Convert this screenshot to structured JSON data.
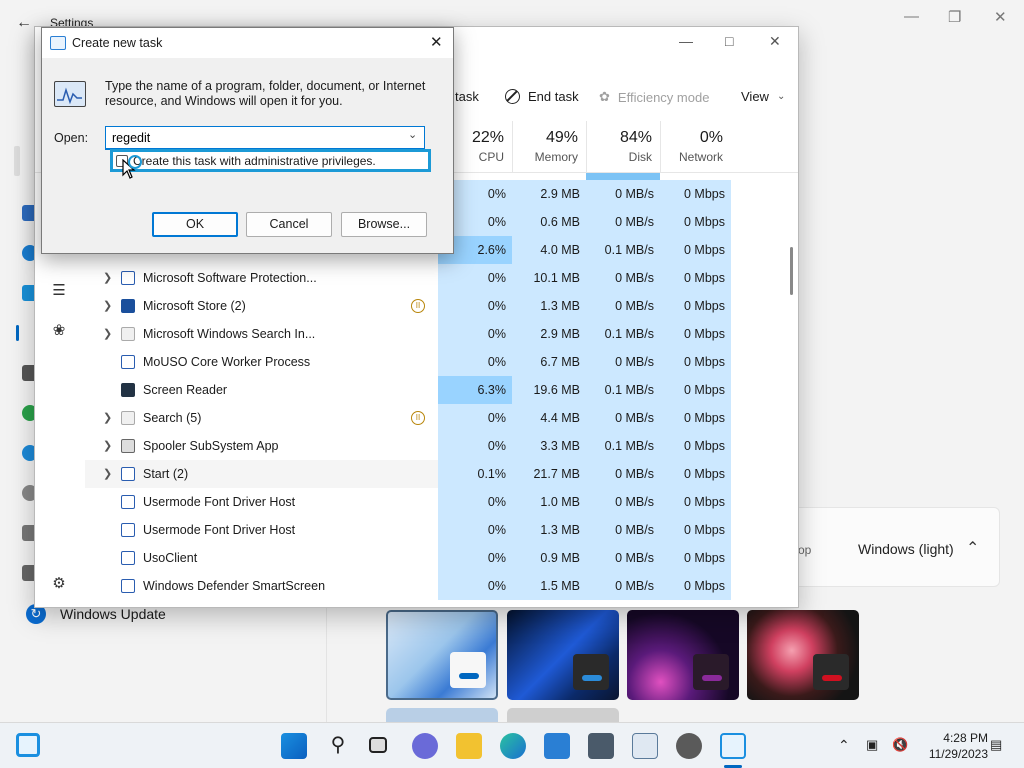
{
  "settings": {
    "title": "Settings",
    "sidebar_bottom_item": "Windows Update",
    "theme_panel": {
      "label": "Windows (light)",
      "partial_text": "op"
    },
    "theme_colors": [
      "#cfe2f5",
      "#0b1a3a",
      "#1a0a2a",
      "#1a1a1a"
    ],
    "theme_accents": [
      "#0067c0",
      "#2b8bd9",
      "#8a2a9a",
      "#d01020"
    ]
  },
  "taskmgr": {
    "toolbar": {
      "run_task_partial": "task",
      "end_task": "End task",
      "efficiency_mode": "Efficiency mode",
      "view": "View"
    },
    "columns": [
      {
        "pct": "22%",
        "name": "CPU"
      },
      {
        "pct": "49%",
        "name": "Memory"
      },
      {
        "pct": "84%",
        "name": "Disk"
      },
      {
        "pct": "0%",
        "name": "Network"
      }
    ],
    "rows": [
      {
        "name": "",
        "expand": false,
        "icon": "",
        "paused": false,
        "cpu": "0%",
        "mem": "2.9 MB",
        "disk": "0 MB/s",
        "net": "0 Mbps",
        "hot": false
      },
      {
        "name": "",
        "expand": false,
        "icon": "",
        "paused": false,
        "cpu": "0%",
        "mem": "0.6 MB",
        "disk": "0 MB/s",
        "net": "0 Mbps",
        "hot": false
      },
      {
        "name": "",
        "expand": false,
        "icon": "",
        "paused": false,
        "cpu": "2.6%",
        "mem": "4.0 MB",
        "disk": "0.1 MB/s",
        "net": "0 Mbps",
        "hot": true
      },
      {
        "name": "Microsoft Software Protection...",
        "expand": true,
        "icon": "app",
        "paused": false,
        "cpu": "0%",
        "mem": "10.1 MB",
        "disk": "0 MB/s",
        "net": "0 Mbps",
        "hot": false
      },
      {
        "name": "Microsoft Store (2)",
        "expand": true,
        "icon": "store",
        "paused": true,
        "cpu": "0%",
        "mem": "1.3 MB",
        "disk": "0 MB/s",
        "net": "0 Mbps",
        "hot": false
      },
      {
        "name": "Microsoft Windows Search In...",
        "expand": true,
        "icon": "search",
        "paused": false,
        "cpu": "0%",
        "mem": "2.9 MB",
        "disk": "0.1 MB/s",
        "net": "0 Mbps",
        "hot": false
      },
      {
        "name": "MoUSO Core Worker Process",
        "expand": false,
        "icon": "app",
        "paused": false,
        "cpu": "0%",
        "mem": "6.7 MB",
        "disk": "0 MB/s",
        "net": "0 Mbps",
        "hot": false
      },
      {
        "name": "Screen Reader",
        "expand": false,
        "icon": "reader",
        "paused": false,
        "cpu": "6.3%",
        "mem": "19.6 MB",
        "disk": "0.1 MB/s",
        "net": "0 Mbps",
        "hot": true
      },
      {
        "name": "Search (5)",
        "expand": true,
        "icon": "search",
        "paused": true,
        "cpu": "0%",
        "mem": "4.4 MB",
        "disk": "0 MB/s",
        "net": "0 Mbps",
        "hot": false
      },
      {
        "name": "Spooler SubSystem App",
        "expand": true,
        "icon": "print",
        "paused": false,
        "cpu": "0%",
        "mem": "3.3 MB",
        "disk": "0.1 MB/s",
        "net": "0 Mbps",
        "hot": false
      },
      {
        "name": "Start (2)",
        "expand": true,
        "icon": "app",
        "paused": false,
        "cpu": "0.1%",
        "mem": "21.7 MB",
        "disk": "0 MB/s",
        "net": "0 Mbps",
        "hot": false,
        "selected": true
      },
      {
        "name": "Usermode Font Driver Host",
        "expand": false,
        "icon": "app",
        "paused": false,
        "cpu": "0%",
        "mem": "1.0 MB",
        "disk": "0 MB/s",
        "net": "0 Mbps",
        "hot": false
      },
      {
        "name": "Usermode Font Driver Host",
        "expand": false,
        "icon": "app",
        "paused": false,
        "cpu": "0%",
        "mem": "1.3 MB",
        "disk": "0 MB/s",
        "net": "0 Mbps",
        "hot": false
      },
      {
        "name": "UsoClient",
        "expand": false,
        "icon": "app",
        "paused": false,
        "cpu": "0%",
        "mem": "0.9 MB",
        "disk": "0 MB/s",
        "net": "0 Mbps",
        "hot": false
      },
      {
        "name": "Windows Defender SmartScreen",
        "expand": false,
        "icon": "app",
        "paused": false,
        "cpu": "0%",
        "mem": "1.5 MB",
        "disk": "0 MB/s",
        "net": "0 Mbps",
        "hot": false
      }
    ]
  },
  "run_dialog": {
    "title": "Create new task",
    "description": "Type the name of a program, folder, document, or Internet resource, and Windows will open it for you.",
    "open_label": "Open:",
    "open_value": "regedit",
    "admin_checkbox_label": "Create this task with administrative privileges.",
    "admin_checked": false,
    "ok": "OK",
    "cancel": "Cancel",
    "browse": "Browse..."
  },
  "taskbar": {
    "time": "4:28 PM",
    "date": "11/29/2023"
  }
}
